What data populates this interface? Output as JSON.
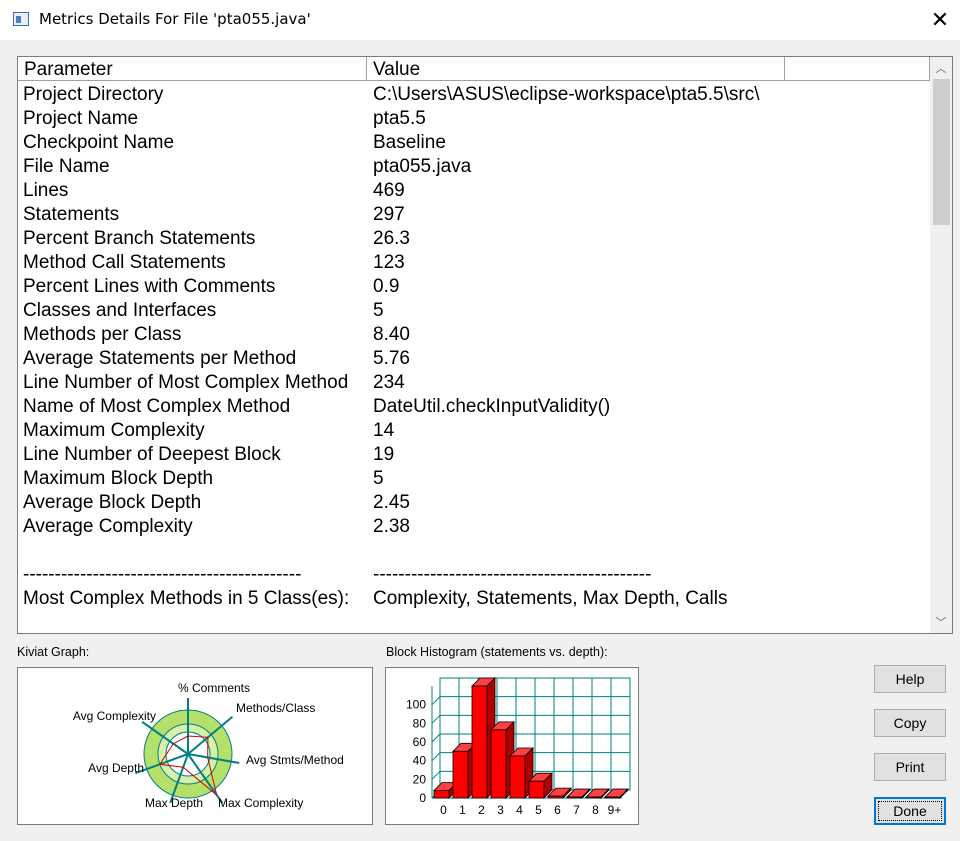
{
  "window": {
    "title": "Metrics Details For File 'pta055.java'",
    "close_glyph": "✕"
  },
  "table": {
    "columns": [
      "Parameter",
      "Value"
    ],
    "rows": [
      [
        "Project Directory",
        "C:\\Users\\ASUS\\eclipse-workspace\\pta5.5\\src\\"
      ],
      [
        "Project Name",
        "pta5.5"
      ],
      [
        "Checkpoint Name",
        "Baseline"
      ],
      [
        "File Name",
        "pta055.java"
      ],
      [
        "Lines",
        "469"
      ],
      [
        "Statements",
        "297"
      ],
      [
        "Percent Branch Statements",
        "26.3"
      ],
      [
        "Method Call Statements",
        "123"
      ],
      [
        "Percent Lines with Comments",
        "0.9"
      ],
      [
        "Classes and Interfaces",
        "5"
      ],
      [
        "Methods per Class",
        "8.40"
      ],
      [
        "Average Statements per Method",
        "5.76"
      ],
      [
        "Line Number of Most Complex Method",
        "234"
      ],
      [
        "Name of Most Complex Method",
        "DateUtil.checkInputValidity()"
      ],
      [
        "Maximum Complexity",
        "14"
      ],
      [
        "Line Number of Deepest Block",
        "19"
      ],
      [
        "Maximum Block Depth",
        "5"
      ],
      [
        "Average Block Depth",
        "2.45"
      ],
      [
        "Average Complexity",
        "2.38"
      ],
      [
        "",
        ""
      ],
      [
        "--------------------------------------------",
        "--------------------------------------------"
      ],
      [
        "Most Complex Methods in 5 Class(es):",
        "Complexity, Statements, Max Depth, Calls"
      ]
    ]
  },
  "kiviat": {
    "label": "Kiviat Graph:",
    "axes": [
      "% Comments",
      "Methods/Class",
      "Avg Stmts/Method",
      "Max Complexity",
      "Max Depth",
      "Avg Depth",
      "Avg Complexity"
    ],
    "ring_color": "#b5e06a",
    "inner_color": "#d8f0a8",
    "axis_color": "#008080",
    "plot_color": "#cc0000"
  },
  "histogram": {
    "label": "Block Histogram (statements vs. depth):",
    "categories": [
      "0",
      "1",
      "2",
      "3",
      "4",
      "5",
      "6",
      "7",
      "8",
      "9+"
    ],
    "values": [
      8,
      50,
      120,
      73,
      45,
      18,
      2,
      1,
      1,
      1
    ],
    "y_ticks": [
      "0",
      "20",
      "40",
      "60",
      "80",
      "100"
    ],
    "ylim": [
      0,
      120
    ],
    "bar_color": "#ff0000",
    "grid_color": "#008080"
  },
  "buttons": {
    "help": "Help",
    "copy": "Copy",
    "print": "Print",
    "done": "Done"
  }
}
